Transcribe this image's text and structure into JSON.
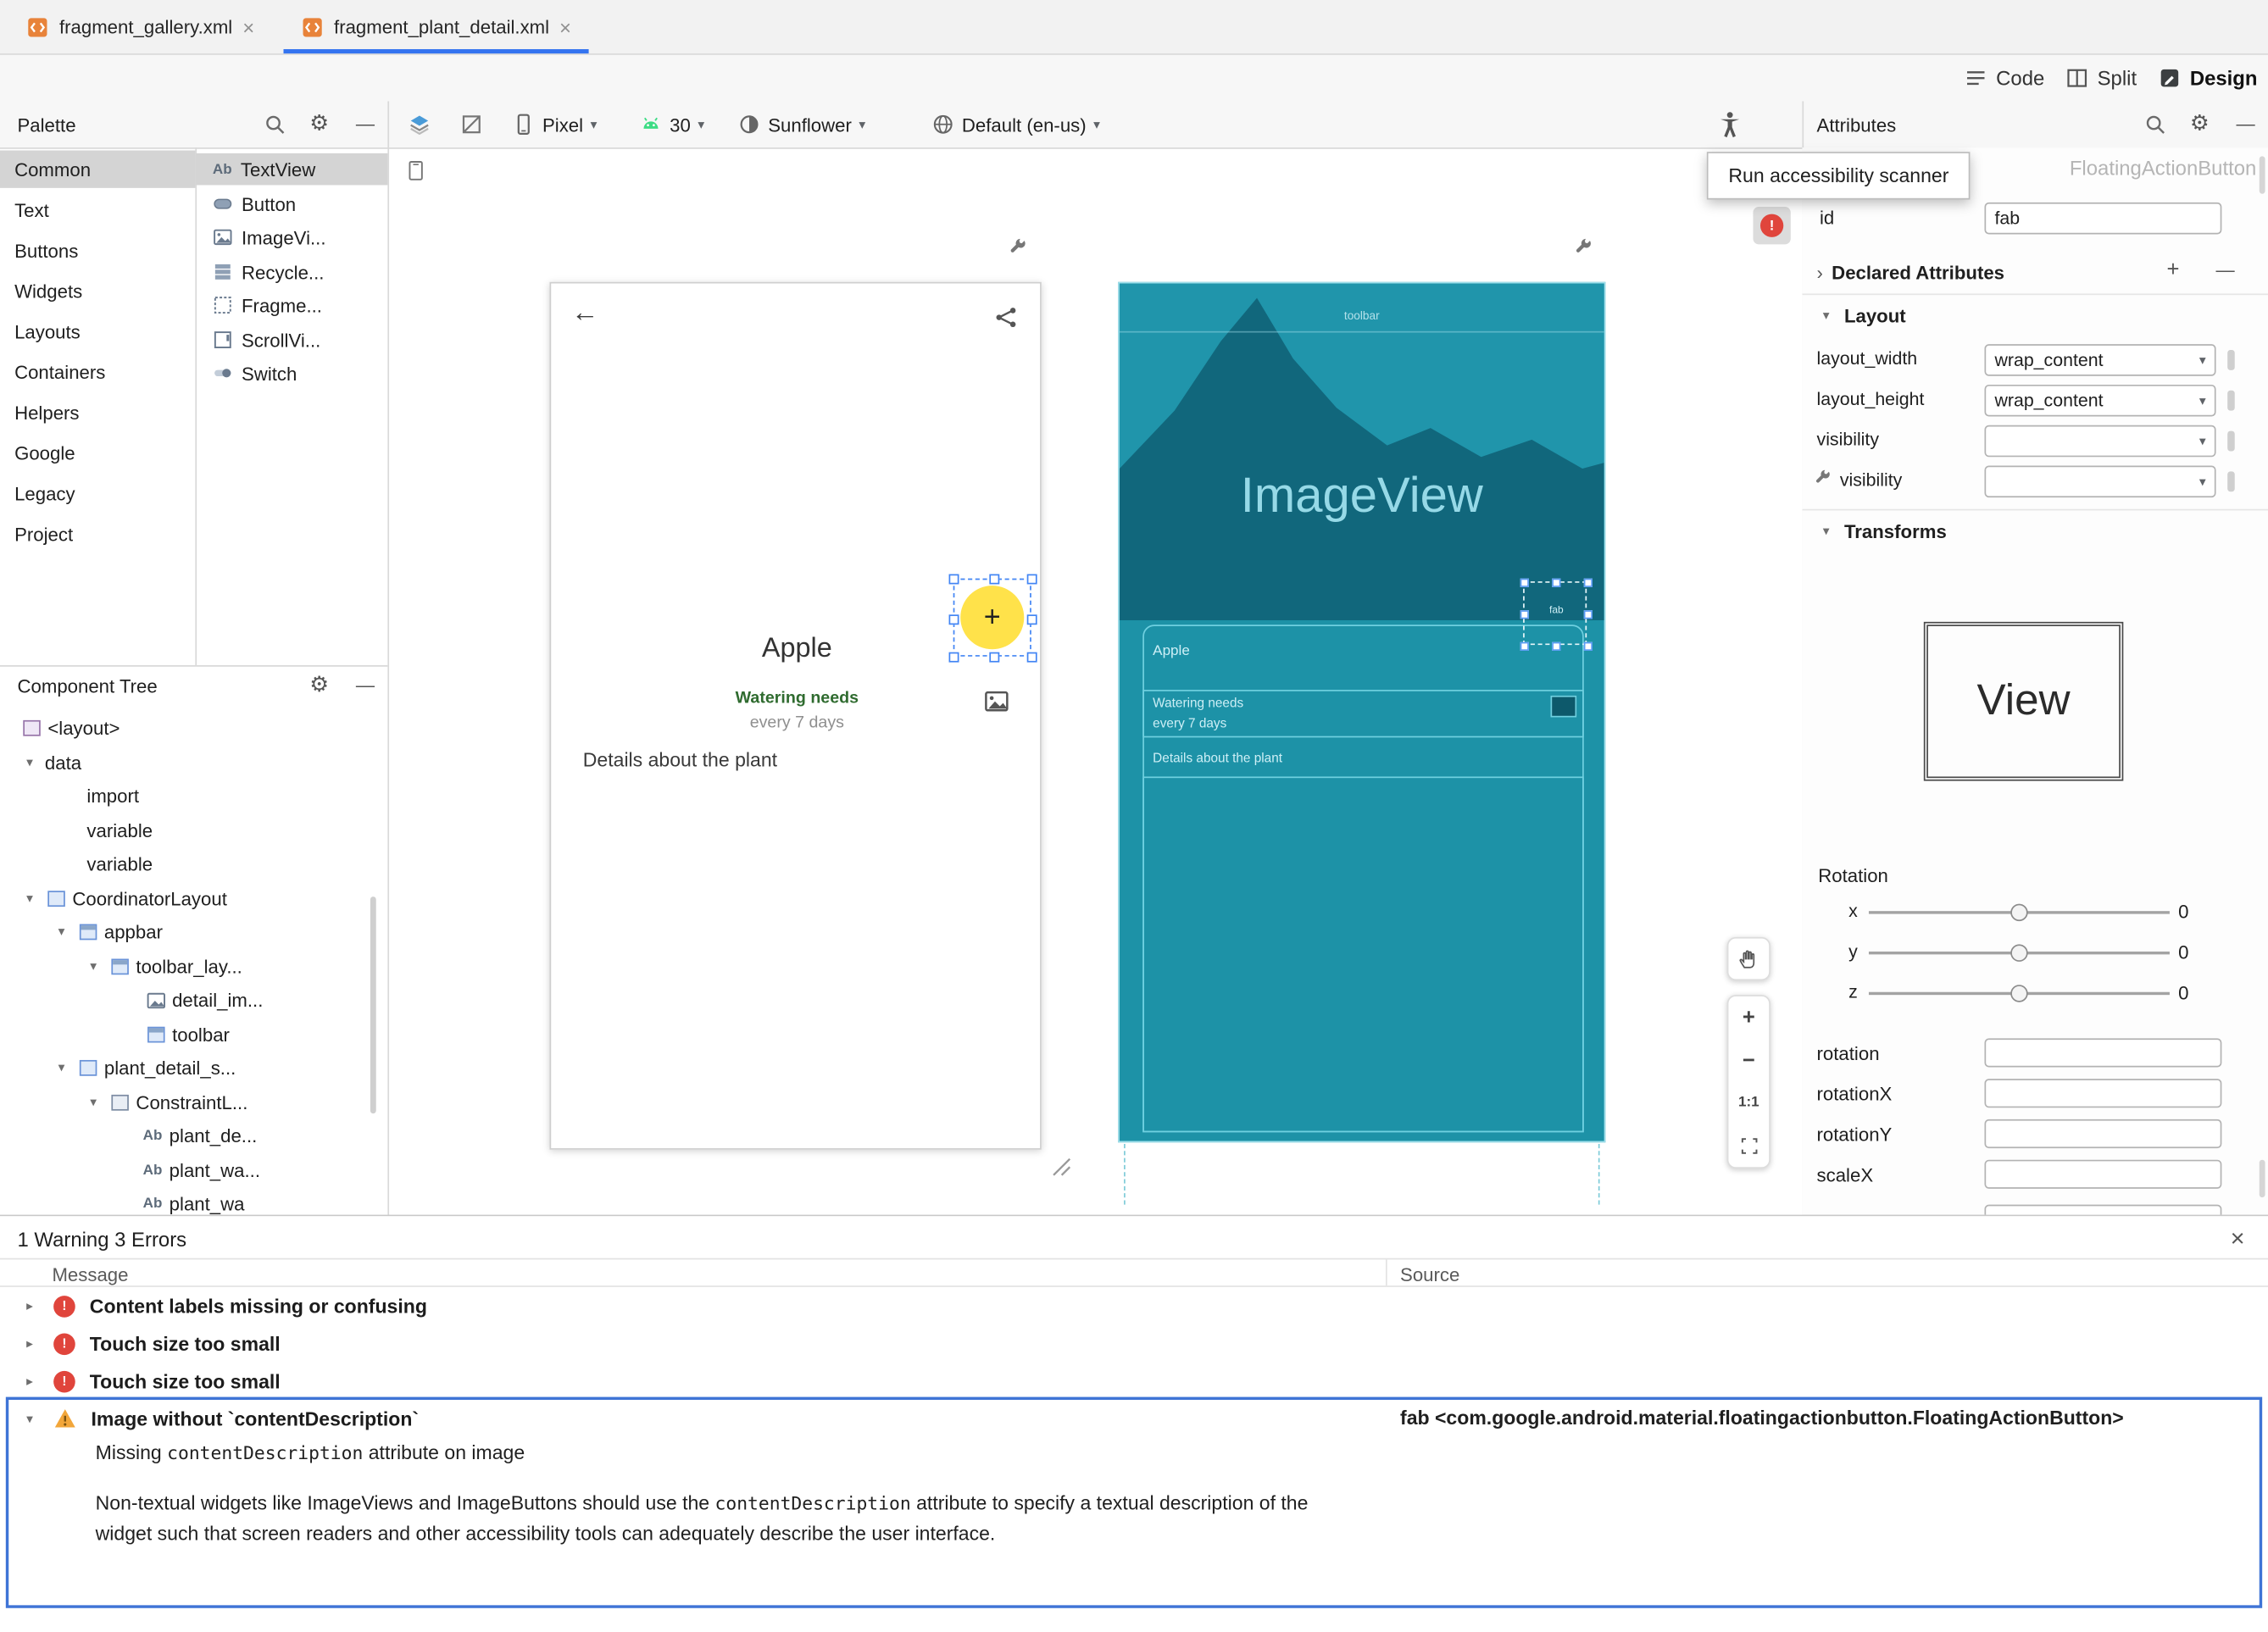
{
  "icons": {
    "close": "×",
    "back_arrow": "←",
    "chevron_down": "▾",
    "chevron_right": "▸",
    "chevron_collapsed": "›",
    "plus": "+",
    "minus": "−",
    "dash": "—",
    "gear": "⚙",
    "fab_plus": "+"
  },
  "colors": {
    "accent_blue": "#3574f0",
    "blueprint_teal": "#1d92a7",
    "blueprint_dark": "#11677c",
    "error_red": "#e0453c",
    "warning_amber": "#f2a63a",
    "fab_yellow": "#ffe24a"
  },
  "tabs": {
    "items": [
      {
        "label": "fragment_gallery.xml"
      },
      {
        "label": "fragment_plant_detail.xml"
      }
    ]
  },
  "mode": {
    "code": "Code",
    "split": "Split",
    "design": "Design"
  },
  "palette": {
    "title": "Palette",
    "categories": [
      {
        "label": "Common"
      },
      {
        "label": "Text"
      },
      {
        "label": "Buttons"
      },
      {
        "label": "Widgets"
      },
      {
        "label": "Layouts"
      },
      {
        "label": "Containers"
      },
      {
        "label": "Helpers"
      },
      {
        "label": "Google"
      },
      {
        "label": "Legacy"
      },
      {
        "label": "Project"
      }
    ],
    "items": [
      {
        "icon_text": "Ab",
        "label": "TextView"
      },
      {
        "label": "Button"
      },
      {
        "label": "ImageVi..."
      },
      {
        "label": "Recycle..."
      },
      {
        "label": "Fragme..."
      },
      {
        "label": "ScrollVi..."
      },
      {
        "label": "Switch"
      }
    ]
  },
  "design_toolbar": {
    "device": "Pixel",
    "api": "30",
    "theme": "Sunflower",
    "locale": "Default (en-us)"
  },
  "tooltip": {
    "text": "Run accessibility scanner"
  },
  "tree": {
    "title": "Component Tree",
    "items": [
      {
        "label": "<layout>"
      },
      {
        "label": "data"
      },
      {
        "label": "import"
      },
      {
        "label": "variable"
      },
      {
        "label": "variable"
      },
      {
        "label": "CoordinatorLayout"
      },
      {
        "label": "appbar"
      },
      {
        "label": "toolbar_lay..."
      },
      {
        "label": "detail_im..."
      },
      {
        "label": "toolbar"
      },
      {
        "label": "plant_detail_s..."
      },
      {
        "label": "ConstraintL..."
      },
      {
        "icon_text": "Ab",
        "label": "plant_de..."
      },
      {
        "icon_text": "Ab",
        "label": "plant_wa..."
      },
      {
        "icon_text": "Ab",
        "label": "plant_wa"
      }
    ]
  },
  "canvas": {
    "design": {
      "title": "Apple",
      "watering_label": "Watering needs",
      "watering_value": "every 7 days",
      "details": "Details about the plant"
    },
    "blueprint": {
      "toolbar_label": "toolbar",
      "image_label": "ImageView",
      "title": "Apple",
      "watering_label": "Watering needs",
      "watering_value": "every 7 days",
      "details": "Details about the plant",
      "fab_label": "fab"
    }
  },
  "zoom": {
    "ratio": "1:1"
  },
  "attributes": {
    "title": "Attributes",
    "component": "FloatingActionButton",
    "id_label": "id",
    "id_value": "fab",
    "declared_label": "Declared Attributes",
    "layout_label": "Layout",
    "rows": [
      {
        "label": "layout_width",
        "value": "wrap_content"
      },
      {
        "label": "layout_height",
        "value": "wrap_content"
      },
      {
        "label": "visibility",
        "value": ""
      },
      {
        "label": "visibility",
        "value": ""
      }
    ],
    "transforms_label": "Transforms",
    "view_label": "View",
    "rotation_label": "Rotation",
    "axes": [
      {
        "axis": "x",
        "value": "0"
      },
      {
        "axis": "y",
        "value": "0"
      },
      {
        "axis": "z",
        "value": "0"
      }
    ],
    "fields": [
      {
        "label": "rotation"
      },
      {
        "label": "rotationX"
      },
      {
        "label": "rotationY"
      },
      {
        "label": "scaleX"
      }
    ]
  },
  "problems": {
    "summary": "1 Warning 3 Errors",
    "columns": {
      "message": "Message",
      "source": "Source"
    },
    "rows": [
      {
        "severity": "error",
        "title": "Content labels missing or confusing"
      },
      {
        "severity": "error",
        "title": "Touch size too small"
      },
      {
        "severity": "error",
        "title": "Touch size too small"
      },
      {
        "severity": "warning",
        "title": "Image without `contentDescription`",
        "source": "fab <com.google.android.material.floatingactionbutton.FloatingActionButton>"
      }
    ],
    "detail": {
      "line1_pre": "Missing ",
      "line1_code": "contentDescription",
      "line1_post": " attribute on image",
      "para_pre": "Non-textual widgets like ImageViews and ImageButtons should use the ",
      "para_code": "contentDescription",
      "para_post": " attribute to specify a textual description of the widget such that screen readers and other accessibility tools can adequately describe the user interface."
    }
  }
}
